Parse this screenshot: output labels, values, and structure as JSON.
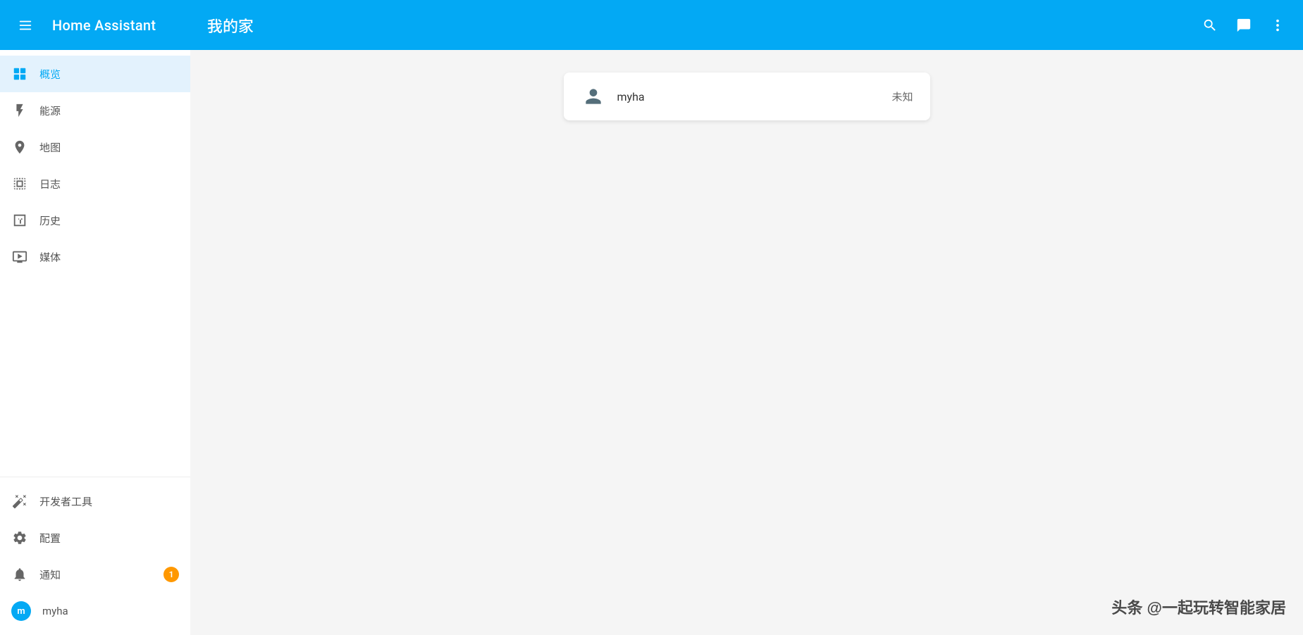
{
  "app": {
    "title": "Home Assistant",
    "page_title": "我的家"
  },
  "topbar": {
    "search_label": "搜索",
    "chat_label": "对话",
    "more_label": "更多"
  },
  "sidebar": {
    "items": [
      {
        "id": "overview",
        "label": "概览",
        "icon": "grid-icon",
        "active": true
      },
      {
        "id": "energy",
        "label": "能源",
        "icon": "energy-icon",
        "active": false
      },
      {
        "id": "map",
        "label": "地图",
        "icon": "map-icon",
        "active": false
      },
      {
        "id": "logbook",
        "label": "日志",
        "icon": "logbook-icon",
        "active": false
      },
      {
        "id": "history",
        "label": "历史",
        "icon": "history-icon",
        "active": false
      },
      {
        "id": "media",
        "label": "媒体",
        "icon": "media-icon",
        "active": false
      }
    ],
    "bottom_items": [
      {
        "id": "developer",
        "label": "开发者工具",
        "icon": "developer-icon"
      },
      {
        "id": "config",
        "label": "配置",
        "icon": "config-icon"
      },
      {
        "id": "notifications",
        "label": "通知",
        "icon": "bell-icon",
        "badge": "1"
      },
      {
        "id": "user",
        "label": "myha",
        "icon": "user-avatar",
        "avatar_letter": "m"
      }
    ]
  },
  "main": {
    "person_card": {
      "name": "myha",
      "status": "未知"
    }
  },
  "watermark": {
    "text": "头条 @一起玩转智能家居"
  },
  "colors": {
    "primary": "#03a9f4",
    "active_bg": "#e3f2fd",
    "badge_bg": "#ff9800",
    "avatar_bg": "#03a9f4"
  }
}
